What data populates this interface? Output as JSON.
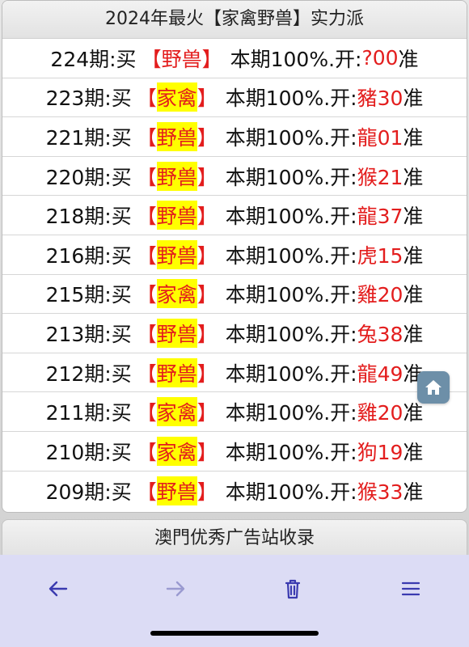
{
  "title": "2024年最火【家禽野兽】实力派",
  "rows": [
    {
      "issue": "224期:买",
      "pick": "野兽",
      "highlight": false,
      "mid": "本期100%.开:",
      "result": "?00",
      "tail": "准"
    },
    {
      "issue": "223期:买",
      "pick": "家禽",
      "highlight": true,
      "mid": "本期100%.开:",
      "result": "豬30",
      "tail": "准"
    },
    {
      "issue": "221期:买",
      "pick": "野兽",
      "highlight": true,
      "mid": "本期100%.开:",
      "result": "龍01",
      "tail": "准"
    },
    {
      "issue": "220期:买",
      "pick": "野兽",
      "highlight": true,
      "mid": "本期100%.开:",
      "result": "猴21",
      "tail": "准"
    },
    {
      "issue": "218期:买",
      "pick": "野兽",
      "highlight": true,
      "mid": "本期100%.开:",
      "result": "龍37",
      "tail": "准"
    },
    {
      "issue": "216期:买",
      "pick": "野兽",
      "highlight": true,
      "mid": "本期100%.开:",
      "result": "虎15",
      "tail": "准"
    },
    {
      "issue": "215期:买",
      "pick": "家禽",
      "highlight": true,
      "mid": "本期100%.开:",
      "result": "雞20",
      "tail": "准"
    },
    {
      "issue": "213期:买",
      "pick": "野兽",
      "highlight": true,
      "mid": "本期100%.开:",
      "result": "兔38",
      "tail": "准"
    },
    {
      "issue": "212期:买",
      "pick": "野兽",
      "highlight": true,
      "mid": "本期100%.开:",
      "result": "龍49",
      "tail": "准"
    },
    {
      "issue": "211期:买",
      "pick": "家禽",
      "highlight": true,
      "mid": "本期100%.开:",
      "result": "雞20",
      "tail": "准"
    },
    {
      "issue": "210期:买",
      "pick": "家禽",
      "highlight": true,
      "mid": "本期100%.开:",
      "result": "狗19",
      "tail": "准"
    },
    {
      "issue": "209期:买",
      "pick": "野兽",
      "highlight": true,
      "mid": "本期100%.开:",
      "result": "猴33",
      "tail": "准"
    }
  ],
  "bracket_open": "【",
  "bracket_close": "】",
  "footer": "澳門优秀广告站收录",
  "home_button_icon": "home-icon",
  "toolbar": {
    "back_icon": "back-arrow-icon",
    "forward_icon": "forward-arrow-icon",
    "delete_icon": "trash-icon",
    "menu_icon": "menu-icon"
  },
  "colors": {
    "accent_red": "#e31d1d",
    "highlight_yellow": "#ffff00",
    "toolbar_bg": "#dcdcf5"
  }
}
